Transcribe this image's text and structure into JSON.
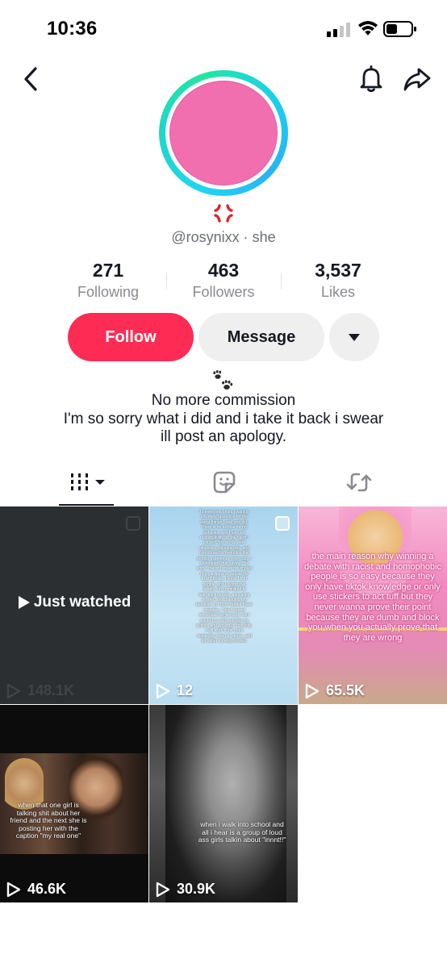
{
  "status_bar": {
    "time": "10:36"
  },
  "profile": {
    "username_line": "@rosynixx · she",
    "avatar_color": "#f16fae",
    "ring_colors": [
      "#1fd5f0",
      "#22e6a2"
    ]
  },
  "stats": {
    "following": {
      "value": "271",
      "label": "Following"
    },
    "followers": {
      "value": "463",
      "label": "Followers"
    },
    "likes": {
      "value": "3,537",
      "label": "Likes"
    }
  },
  "buttons": {
    "follow": "Follow",
    "message": "Message"
  },
  "bio": {
    "line1": "No more commission",
    "line2": "I'm so sorry what i did and i take it back i swear",
    "line3": "ill post an apology."
  },
  "tabs": [
    "videos-grid-icon",
    "favorites-icon",
    "repost-icon"
  ],
  "colors": {
    "accent": "#fe2c55",
    "button_gray": "#efefef",
    "muted_text": "#8a8b91"
  },
  "videos": [
    {
      "overlay": "Just watched",
      "views": "148.1K"
    },
    {
      "views": "12",
      "caption": "To everyone I hurt, I want to sincerely apologize for the racist things I said and did. There is no excuse for my behavior, and I take full responsibility for the harm I caused. My words were offensive, disrespectful, and contributed to prejudice that people experience every day. I understand that saying \"I'm sorry\" doesn't erase the impact of my actions or rebuild the trust I broke. I know I hurt people, and I regret that deeply. I'm committed to learning from this, educating myself, and changing my behavior so I don't repeat these mistakes. I don't expect immediate forgiveness, but I wanted to acknowledge my actions and apologize honestly. I will work to be more respectful, listen to others, and do better moving forward."
    },
    {
      "views": "65.5K",
      "caption": "the main reason why winning a debate with racist and homophobic people is so easy because they only have tiktok knowledge or only use stickers to act tuff but they never wanna prove their point because they are dumb and block you when you actually prove that they are wrong"
    },
    {
      "views": "46.6K",
      "caption": "when that one girl is talking shit about her friend and the next she is posting her with the caption \"my real one\""
    },
    {
      "views": "30.9K",
      "caption": "when i walk into school and all i hear is a group of loud ass girls talkin about \"innnt!!\""
    }
  ]
}
